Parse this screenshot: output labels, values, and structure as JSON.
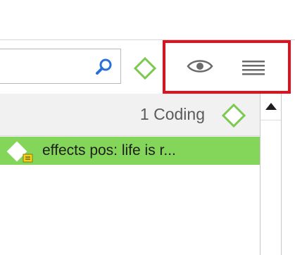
{
  "toolbar": {
    "search_icon": "search-icon",
    "code_icon": "diamond-icon",
    "view_icon": "eye-icon",
    "menu_icon": "hamburger-menu-icon",
    "highlight_color": "#e1101d"
  },
  "list": {
    "header": {
      "count_label": "1 Coding",
      "icon": "diamond-icon"
    },
    "rows": [
      {
        "label": "effects pos: life is r...",
        "icon": "code-memo-icon",
        "background": "#84d65a"
      }
    ]
  },
  "colors": {
    "code_green": "#7cc94f",
    "selected_row": "#84d65a",
    "search_blue": "#2a6fd6"
  }
}
